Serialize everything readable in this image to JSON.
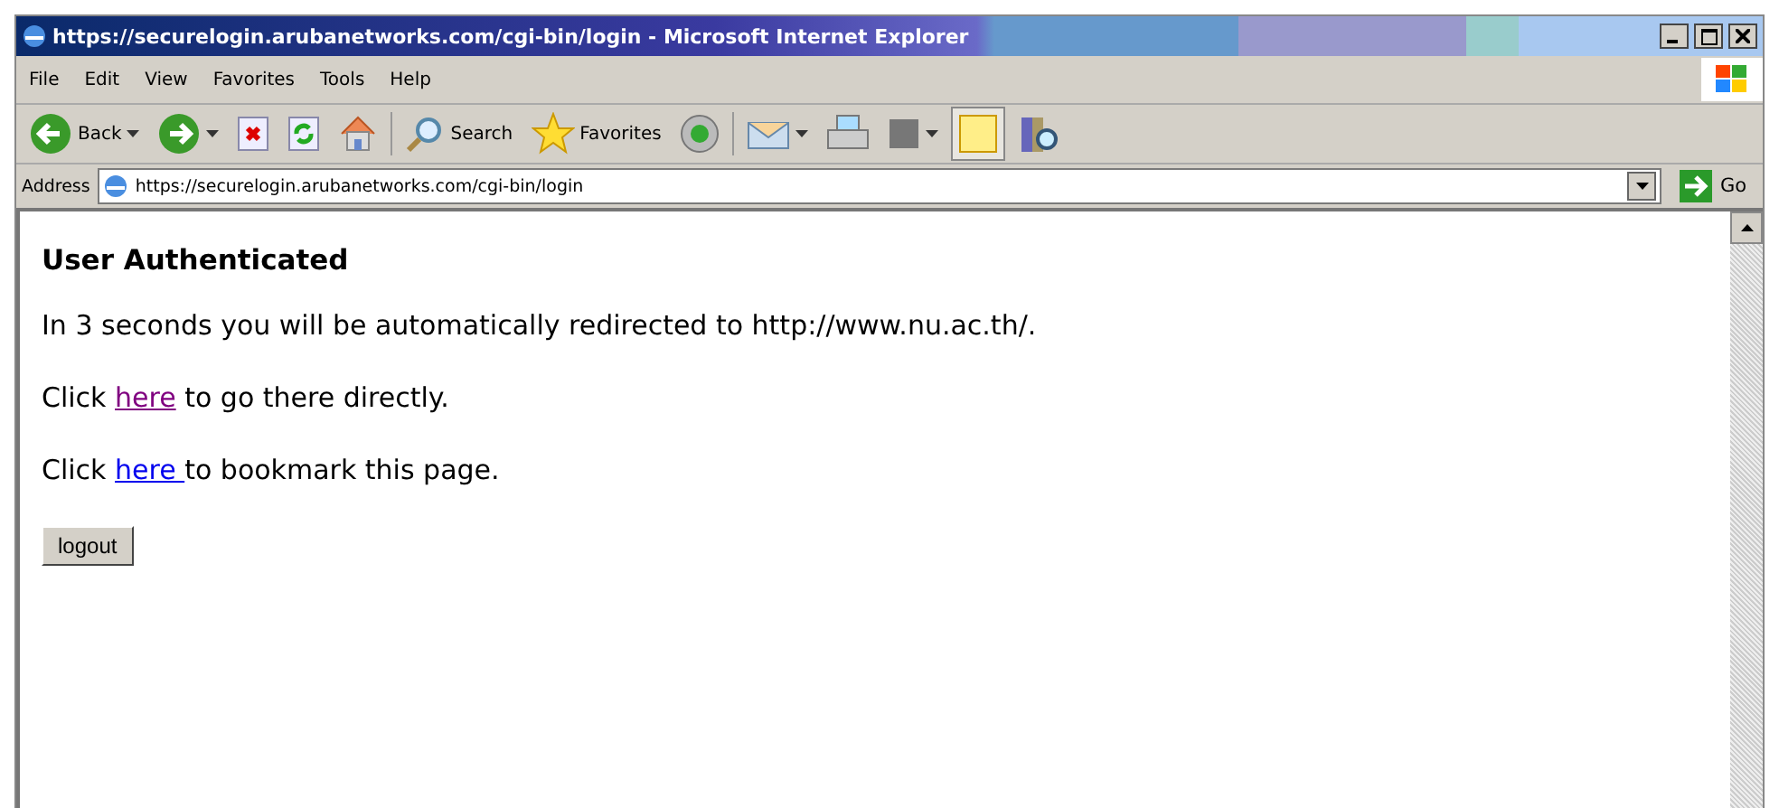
{
  "window": {
    "title": "https://securelogin.arubanetworks.com/cgi-bin/login - Microsoft Internet Explorer"
  },
  "menu": [
    "File",
    "Edit",
    "View",
    "Favorites",
    "Tools",
    "Help"
  ],
  "toolbar": [
    {
      "kind": "back",
      "label": "Back"
    },
    {
      "kind": "forward"
    },
    {
      "kind": "stop"
    },
    {
      "kind": "refresh"
    },
    {
      "kind": "home"
    },
    {
      "kind": "sep"
    },
    {
      "kind": "search",
      "label": "Search"
    },
    {
      "kind": "favorites",
      "label": "Favorites"
    },
    {
      "kind": "media"
    },
    {
      "kind": "sep"
    },
    {
      "kind": "mail"
    },
    {
      "kind": "print"
    },
    {
      "kind": "edit"
    },
    {
      "kind": "note",
      "selected": true
    },
    {
      "kind": "research",
      "selected": false
    }
  ],
  "address": {
    "label": "Address",
    "value": "https://securelogin.arubanetworks.com/cgi-bin/login",
    "go": "Go"
  },
  "page": {
    "heading": "User Authenticated",
    "paragraphs": [
      {
        "before": "In 3 seconds you will be automatically redirected to http://www.nu.ac.th/."
      },
      {
        "before": "Click ",
        "link": "here",
        "visited": true,
        "after": " to go there directly."
      },
      {
        "before": "Click ",
        "link": "here ",
        "visited": false,
        "after": "to bookmark this page."
      }
    ],
    "button": "logout"
  }
}
